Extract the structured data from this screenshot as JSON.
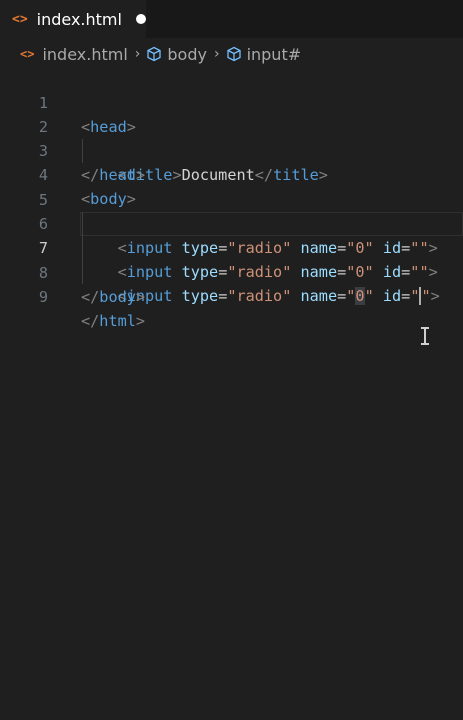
{
  "tab": {
    "filename": "index.html",
    "icon": "html-file-icon",
    "modified_indicator": "unsaved-dot"
  },
  "breadcrumb": {
    "file": "index.html",
    "items": [
      "body",
      "input#"
    ]
  },
  "editor": {
    "active_line": 7,
    "lines": [
      {
        "number": "1",
        "text": "<head>"
      },
      {
        "number": "2",
        "text": "<title>Document</title>"
      },
      {
        "number": "3",
        "text": "</head>"
      },
      {
        "number": "4",
        "text": "<body>"
      },
      {
        "number": "5",
        "text": "<input type=\"radio\" name=\"0\" id=\"\">"
      },
      {
        "number": "6",
        "text": "<input type=\"radio\" name=\"0\" id=\"\">"
      },
      {
        "number": "7",
        "text": "<input type=\"radio\" name=\"0\" id=\"\">"
      },
      {
        "number": "8",
        "text": "</body>"
      },
      {
        "number": "9",
        "text": "</html>"
      }
    ]
  },
  "colors": {
    "background": "#1f1f1f",
    "tag": "#569cd6",
    "attribute": "#9cdcfe",
    "string": "#ce9178",
    "bracket": "#808080",
    "html_icon": "#e37933"
  }
}
